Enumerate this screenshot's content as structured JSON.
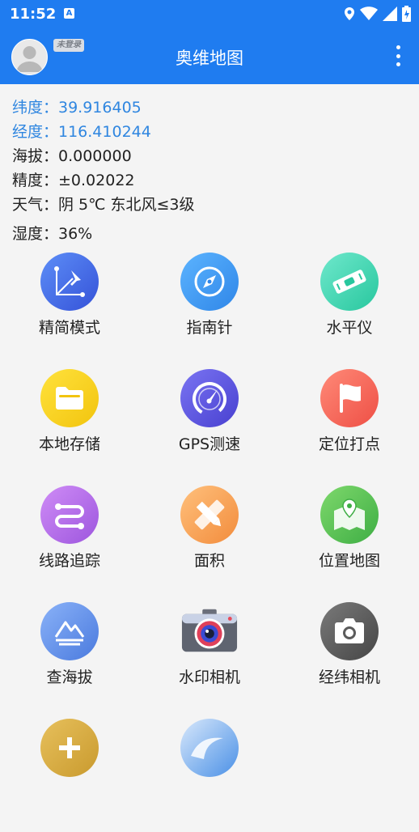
{
  "status_bar": {
    "time": "11:52"
  },
  "app_bar": {
    "title": "奥维地图",
    "login_badge": "未登录"
  },
  "info": {
    "latitude": "纬度：39.916405",
    "longitude": "经度：116.410244",
    "altitude": "海拔：0.000000",
    "accuracy": "精度：±0.02022",
    "weather": "天气：阴  5℃  东北风≤3级",
    "humidity": "湿度：36%"
  },
  "tools": [
    {
      "label": "精简模式",
      "icon": "pin-square-icon",
      "color": "#3a63e5"
    },
    {
      "label": "指南针",
      "icon": "compass-icon",
      "color": "#3a9af0"
    },
    {
      "label": "水平仪",
      "icon": "level-icon",
      "color": "#3dd4b0"
    },
    {
      "label": "本地存储",
      "icon": "folder-icon",
      "color": "#f4cb1e"
    },
    {
      "label": "GPS测速",
      "icon": "speedometer-icon",
      "color": "#5a54dc"
    },
    {
      "label": "定位打点",
      "icon": "flag-icon",
      "color": "#f56a5c"
    },
    {
      "label": "线路追踪",
      "icon": "route-icon",
      "color": "#b269e6"
    },
    {
      "label": "面积",
      "icon": "ruler-pencil-icon",
      "color": "#f6a45a"
    },
    {
      "label": "位置地图",
      "icon": "map-pin-icon",
      "color": "#57c45a"
    },
    {
      "label": "查海拔",
      "icon": "mountain-icon",
      "color": "#5a8ae8"
    },
    {
      "label": "水印相机",
      "icon": "camera-color-icon",
      "color": "#e8eaf0"
    },
    {
      "label": "经纬相机",
      "icon": "camera-icon",
      "color": "#5b5b5b"
    },
    {
      "label": "",
      "icon": "plus-icon",
      "color": "#d9b04a"
    },
    {
      "label": "",
      "icon": "wave-icon",
      "color": "#4a90e6"
    }
  ]
}
